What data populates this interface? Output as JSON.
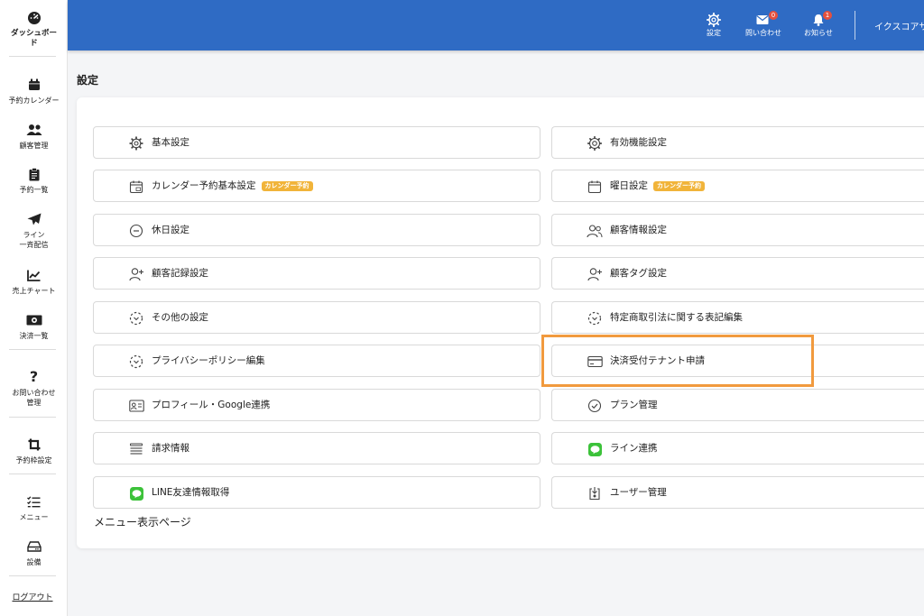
{
  "sidebar": {
    "items": [
      {
        "label": "ダッシュボー\nド",
        "icon": "dashboard-gauge-icon"
      },
      {
        "label": "予約カレンダー",
        "icon": "calendar-icon"
      },
      {
        "label": "顧客管理",
        "icon": "users-icon"
      },
      {
        "label": "予約一覧",
        "icon": "clipboard-icon"
      },
      {
        "label": "ライン\n一斉配信",
        "icon": "paper-plane-icon"
      },
      {
        "label": "売上チャート",
        "icon": "line-chart-icon"
      },
      {
        "label": "決済一覧",
        "icon": "money-bill-icon"
      },
      {
        "label": "お問い合わせ\n管理",
        "icon": "question-mark-icon"
      },
      {
        "label": "予約枠設定",
        "icon": "crop-icon"
      },
      {
        "label": "メニュー",
        "icon": "list-check-icon"
      },
      {
        "label": "設備",
        "icon": "hdd-icon"
      }
    ],
    "logout": "ログアウト"
  },
  "header": {
    "settings": {
      "label": "設定",
      "icon": "gear-icon"
    },
    "contact": {
      "label": "問い合わせ",
      "icon": "envelope-icon",
      "badge": "0"
    },
    "notice": {
      "label": "お知らせ",
      "icon": "bell-icon",
      "badge": "1"
    },
    "user": "イクスコアサ",
    "colors": {
      "bar": "#2f6bc4",
      "badge": "#e5503d"
    }
  },
  "main": {
    "title": "設定",
    "tag_color": "#f1b43a",
    "highlight_color": "#f19a3e",
    "buttons_left": [
      {
        "label": "基本設定",
        "icon": "gear-icon"
      },
      {
        "label": "カレンダー予約基本設定",
        "icon": "calendar-icon",
        "tag": "カレンダー予約"
      },
      {
        "label": "休日設定",
        "icon": "minus-circle-icon"
      },
      {
        "label": "顧客記録設定",
        "icon": "user-plus-icon"
      },
      {
        "label": "その他の設定",
        "icon": "dashed-circle-icon"
      },
      {
        "label": "プライバシーポリシー編集",
        "icon": "dashed-circle-icon"
      },
      {
        "label": "プロフィール・Google連携",
        "icon": "id-card-icon"
      },
      {
        "label": "請求情報",
        "icon": "stack-lines-icon"
      },
      {
        "label": "LINE友達情報取得",
        "icon": "line-app-icon"
      }
    ],
    "buttons_right": [
      {
        "label": "有効機能設定",
        "icon": "cog-circle-icon"
      },
      {
        "label": "曜日設定",
        "icon": "calendar-icon",
        "tag": "カレンダー予約"
      },
      {
        "label": "顧客情報設定",
        "icon": "users-icon"
      },
      {
        "label": "顧客タグ設定",
        "icon": "user-plus-icon"
      },
      {
        "label": "特定商取引法に関する表記編集",
        "icon": "dashed-circle-icon"
      },
      {
        "label": "決済受付テナント申請",
        "icon": "credit-card-icon"
      },
      {
        "label": "プラン管理",
        "icon": "check-circle-icon"
      },
      {
        "label": "ライン連携",
        "icon": "line-app-icon"
      },
      {
        "label": "ユーザー管理",
        "icon": "user-download-icon"
      }
    ],
    "menu_page": "メニュー表示ページ"
  }
}
